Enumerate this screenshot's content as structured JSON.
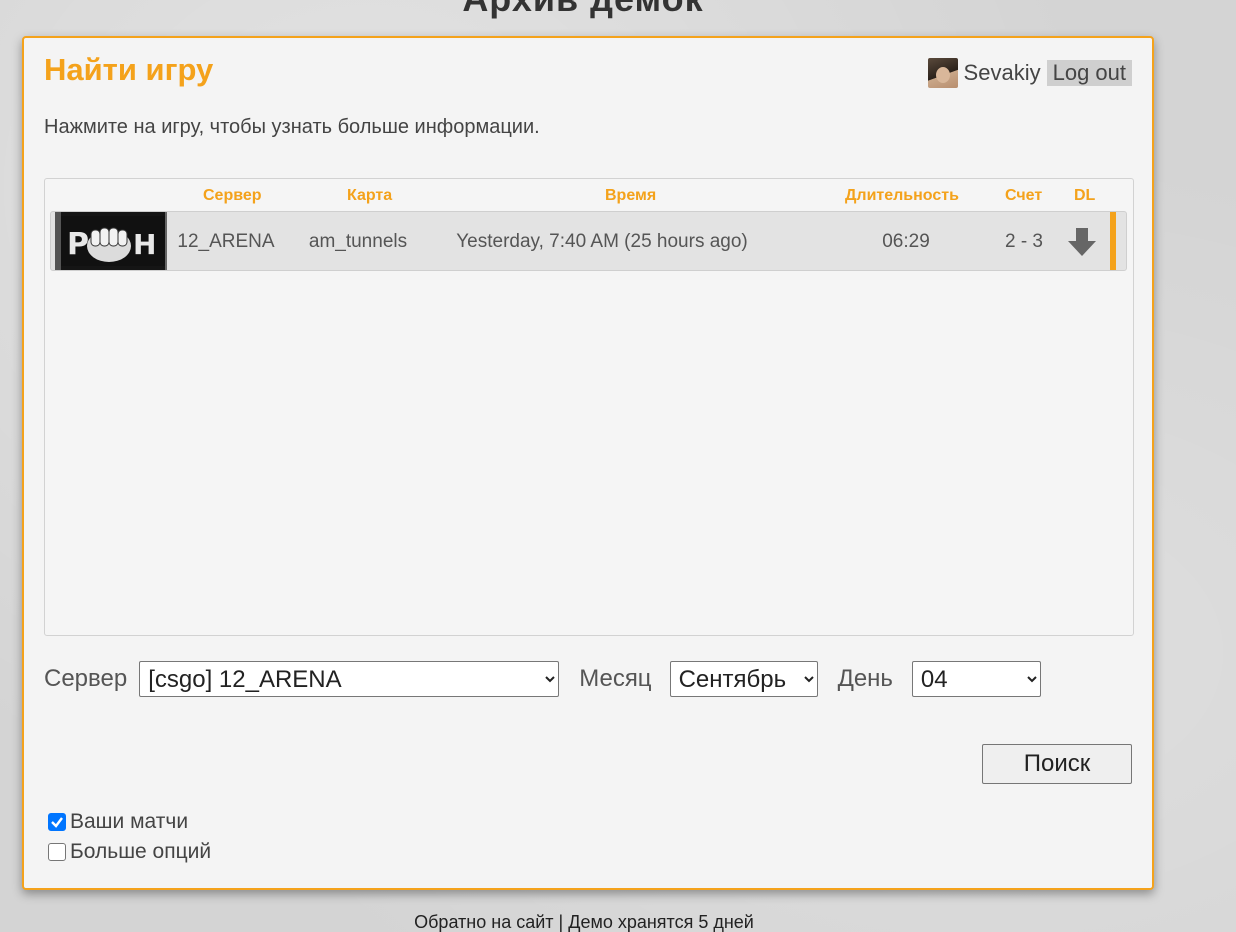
{
  "page": {
    "heading": "Архив демок",
    "footer": {
      "back_link": "Обратно на сайт",
      "separator": "|",
      "retention_note": "Демо хранятся 5 дней"
    }
  },
  "panel": {
    "title": "Найти игру",
    "subtitle": "Нажмите на игру, чтобы узнать больше информации.",
    "user": {
      "name": "Sevakiy",
      "logout_label": "Log out"
    }
  },
  "games": {
    "columns": {
      "server": "Сервер",
      "map": "Карта",
      "time": "Время",
      "duration": "Длительность",
      "score": "Счет",
      "dl": "DL"
    },
    "rows": [
      {
        "server_logo_text": "PUNCH",
        "server": "12_ARENA",
        "map": "am_tunnels",
        "time": "Yesterday, 7:40 AM (25 hours ago)",
        "duration": "06:29",
        "score": "2 - 3",
        "download_icon": "download-arrow-icon"
      }
    ]
  },
  "filters": {
    "server_label": "Сервер",
    "server_value": "[csgo] 12_ARENA",
    "month_label": "Месяц",
    "month_value": "Сентябрь",
    "day_label": "День",
    "day_value": "04",
    "search_label": "Поиск"
  },
  "options": {
    "your_matches": {
      "label": "Ваши матчи",
      "checked": true
    },
    "more_options": {
      "label": "Больше опций",
      "checked": false
    }
  },
  "colors": {
    "accent": "#f4a21b",
    "checkbox": "#0075ff"
  }
}
